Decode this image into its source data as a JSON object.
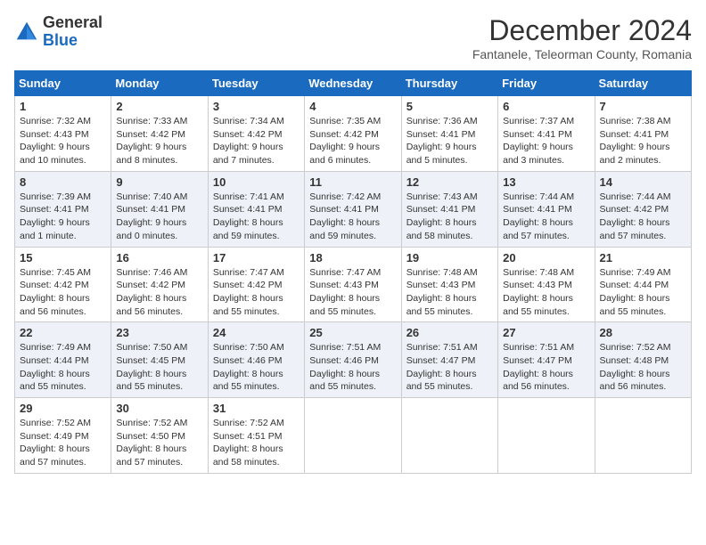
{
  "header": {
    "logo_general": "General",
    "logo_blue": "Blue",
    "month_title": "December 2024",
    "location": "Fantanele, Teleorman County, Romania"
  },
  "columns": [
    "Sunday",
    "Monday",
    "Tuesday",
    "Wednesday",
    "Thursday",
    "Friday",
    "Saturday"
  ],
  "weeks": [
    [
      {
        "day": "1",
        "sunrise": "7:32 AM",
        "sunset": "4:43 PM",
        "daylight": "9 hours and 10 minutes."
      },
      {
        "day": "2",
        "sunrise": "7:33 AM",
        "sunset": "4:42 PM",
        "daylight": "9 hours and 8 minutes."
      },
      {
        "day": "3",
        "sunrise": "7:34 AM",
        "sunset": "4:42 PM",
        "daylight": "9 hours and 7 minutes."
      },
      {
        "day": "4",
        "sunrise": "7:35 AM",
        "sunset": "4:42 PM",
        "daylight": "9 hours and 6 minutes."
      },
      {
        "day": "5",
        "sunrise": "7:36 AM",
        "sunset": "4:41 PM",
        "daylight": "9 hours and 5 minutes."
      },
      {
        "day": "6",
        "sunrise": "7:37 AM",
        "sunset": "4:41 PM",
        "daylight": "9 hours and 3 minutes."
      },
      {
        "day": "7",
        "sunrise": "7:38 AM",
        "sunset": "4:41 PM",
        "daylight": "9 hours and 2 minutes."
      }
    ],
    [
      {
        "day": "8",
        "sunrise": "7:39 AM",
        "sunset": "4:41 PM",
        "daylight": "9 hours and 1 minute."
      },
      {
        "day": "9",
        "sunrise": "7:40 AM",
        "sunset": "4:41 PM",
        "daylight": "9 hours and 0 minutes."
      },
      {
        "day": "10",
        "sunrise": "7:41 AM",
        "sunset": "4:41 PM",
        "daylight": "8 hours and 59 minutes."
      },
      {
        "day": "11",
        "sunrise": "7:42 AM",
        "sunset": "4:41 PM",
        "daylight": "8 hours and 59 minutes."
      },
      {
        "day": "12",
        "sunrise": "7:43 AM",
        "sunset": "4:41 PM",
        "daylight": "8 hours and 58 minutes."
      },
      {
        "day": "13",
        "sunrise": "7:44 AM",
        "sunset": "4:41 PM",
        "daylight": "8 hours and 57 minutes."
      },
      {
        "day": "14",
        "sunrise": "7:44 AM",
        "sunset": "4:42 PM",
        "daylight": "8 hours and 57 minutes."
      }
    ],
    [
      {
        "day": "15",
        "sunrise": "7:45 AM",
        "sunset": "4:42 PM",
        "daylight": "8 hours and 56 minutes."
      },
      {
        "day": "16",
        "sunrise": "7:46 AM",
        "sunset": "4:42 PM",
        "daylight": "8 hours and 56 minutes."
      },
      {
        "day": "17",
        "sunrise": "7:47 AM",
        "sunset": "4:42 PM",
        "daylight": "8 hours and 55 minutes."
      },
      {
        "day": "18",
        "sunrise": "7:47 AM",
        "sunset": "4:43 PM",
        "daylight": "8 hours and 55 minutes."
      },
      {
        "day": "19",
        "sunrise": "7:48 AM",
        "sunset": "4:43 PM",
        "daylight": "8 hours and 55 minutes."
      },
      {
        "day": "20",
        "sunrise": "7:48 AM",
        "sunset": "4:43 PM",
        "daylight": "8 hours and 55 minutes."
      },
      {
        "day": "21",
        "sunrise": "7:49 AM",
        "sunset": "4:44 PM",
        "daylight": "8 hours and 55 minutes."
      }
    ],
    [
      {
        "day": "22",
        "sunrise": "7:49 AM",
        "sunset": "4:44 PM",
        "daylight": "8 hours and 55 minutes."
      },
      {
        "day": "23",
        "sunrise": "7:50 AM",
        "sunset": "4:45 PM",
        "daylight": "8 hours and 55 minutes."
      },
      {
        "day": "24",
        "sunrise": "7:50 AM",
        "sunset": "4:46 PM",
        "daylight": "8 hours and 55 minutes."
      },
      {
        "day": "25",
        "sunrise": "7:51 AM",
        "sunset": "4:46 PM",
        "daylight": "8 hours and 55 minutes."
      },
      {
        "day": "26",
        "sunrise": "7:51 AM",
        "sunset": "4:47 PM",
        "daylight": "8 hours and 55 minutes."
      },
      {
        "day": "27",
        "sunrise": "7:51 AM",
        "sunset": "4:47 PM",
        "daylight": "8 hours and 56 minutes."
      },
      {
        "day": "28",
        "sunrise": "7:52 AM",
        "sunset": "4:48 PM",
        "daylight": "8 hours and 56 minutes."
      }
    ],
    [
      {
        "day": "29",
        "sunrise": "7:52 AM",
        "sunset": "4:49 PM",
        "daylight": "8 hours and 57 minutes."
      },
      {
        "day": "30",
        "sunrise": "7:52 AM",
        "sunset": "4:50 PM",
        "daylight": "8 hours and 57 minutes."
      },
      {
        "day": "31",
        "sunrise": "7:52 AM",
        "sunset": "4:51 PM",
        "daylight": "8 hours and 58 minutes."
      },
      null,
      null,
      null,
      null
    ]
  ]
}
